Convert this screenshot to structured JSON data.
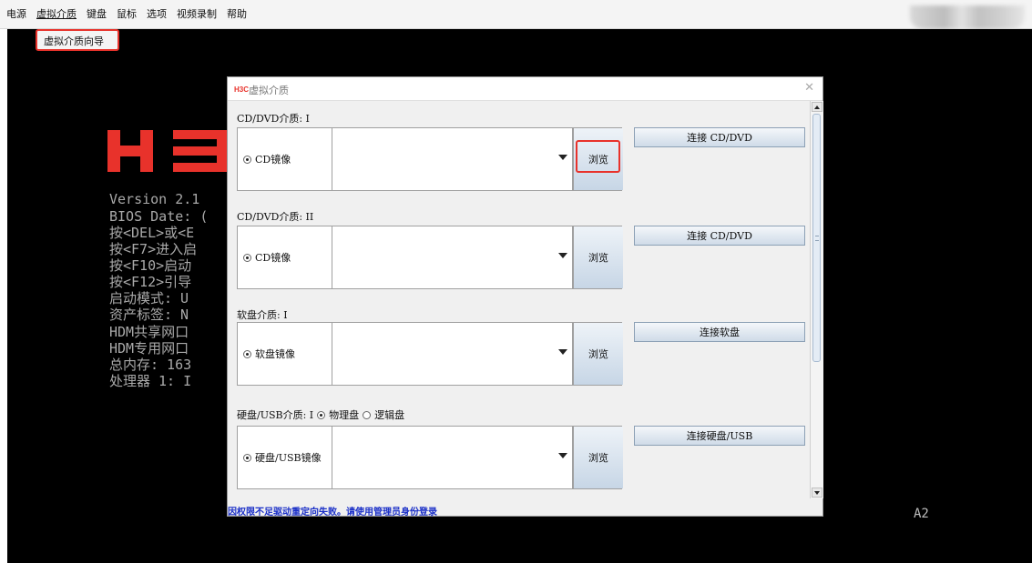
{
  "menubar": {
    "items": [
      {
        "label": "电源"
      },
      {
        "label": "虚拟介质"
      },
      {
        "label": "键盘"
      },
      {
        "label": "鼠标"
      },
      {
        "label": "选项"
      },
      {
        "label": "视频录制"
      },
      {
        "label": "帮助"
      }
    ],
    "dropdown_item": "虚拟介质向导"
  },
  "console": {
    "logo_text": "H3",
    "lines": [
      "Version 2.1",
      "BIOS Date: (",
      "按<DEL>或<E",
      "按<F7>进入启",
      "按<F10>启动",
      "按<F12>引导",
      "启动模式: U",
      "资产标签: N",
      "HDM共享网口",
      "HDM专用网口",
      "总内存: 163",
      "处理器 1: I"
    ],
    "corner_label": "A2"
  },
  "dialog": {
    "logo": "H3C",
    "title": "虚拟介质",
    "close_icon": "close-icon",
    "sections": [
      {
        "label": "CD/DVD介质: I",
        "radio_label": "CD镜像",
        "browse": "浏览",
        "connect": "连接 CD/DVD",
        "path": ""
      },
      {
        "label": "CD/DVD介质: II",
        "radio_label": "CD镜像",
        "browse": "浏览",
        "connect": "连接 CD/DVD",
        "path": ""
      },
      {
        "label": "软盘介质: I",
        "radio_label": "软盘镜像",
        "browse": "浏览",
        "connect": "连接软盘",
        "path": ""
      },
      {
        "label": "硬盘/USB介质: I",
        "radio_label": "硬盘/USB镜像",
        "browse": "浏览",
        "connect": "连接硬盘/USB",
        "path": ""
      }
    ],
    "usb_options": {
      "physical": "物理盘",
      "logical": "逻辑盘",
      "selected": "physical"
    },
    "status": "因权限不足驱动重定向失败。请使用管理员身份登录"
  },
  "colors": {
    "accent_red": "#e8322b",
    "status_blue": "#1a2fc7"
  }
}
